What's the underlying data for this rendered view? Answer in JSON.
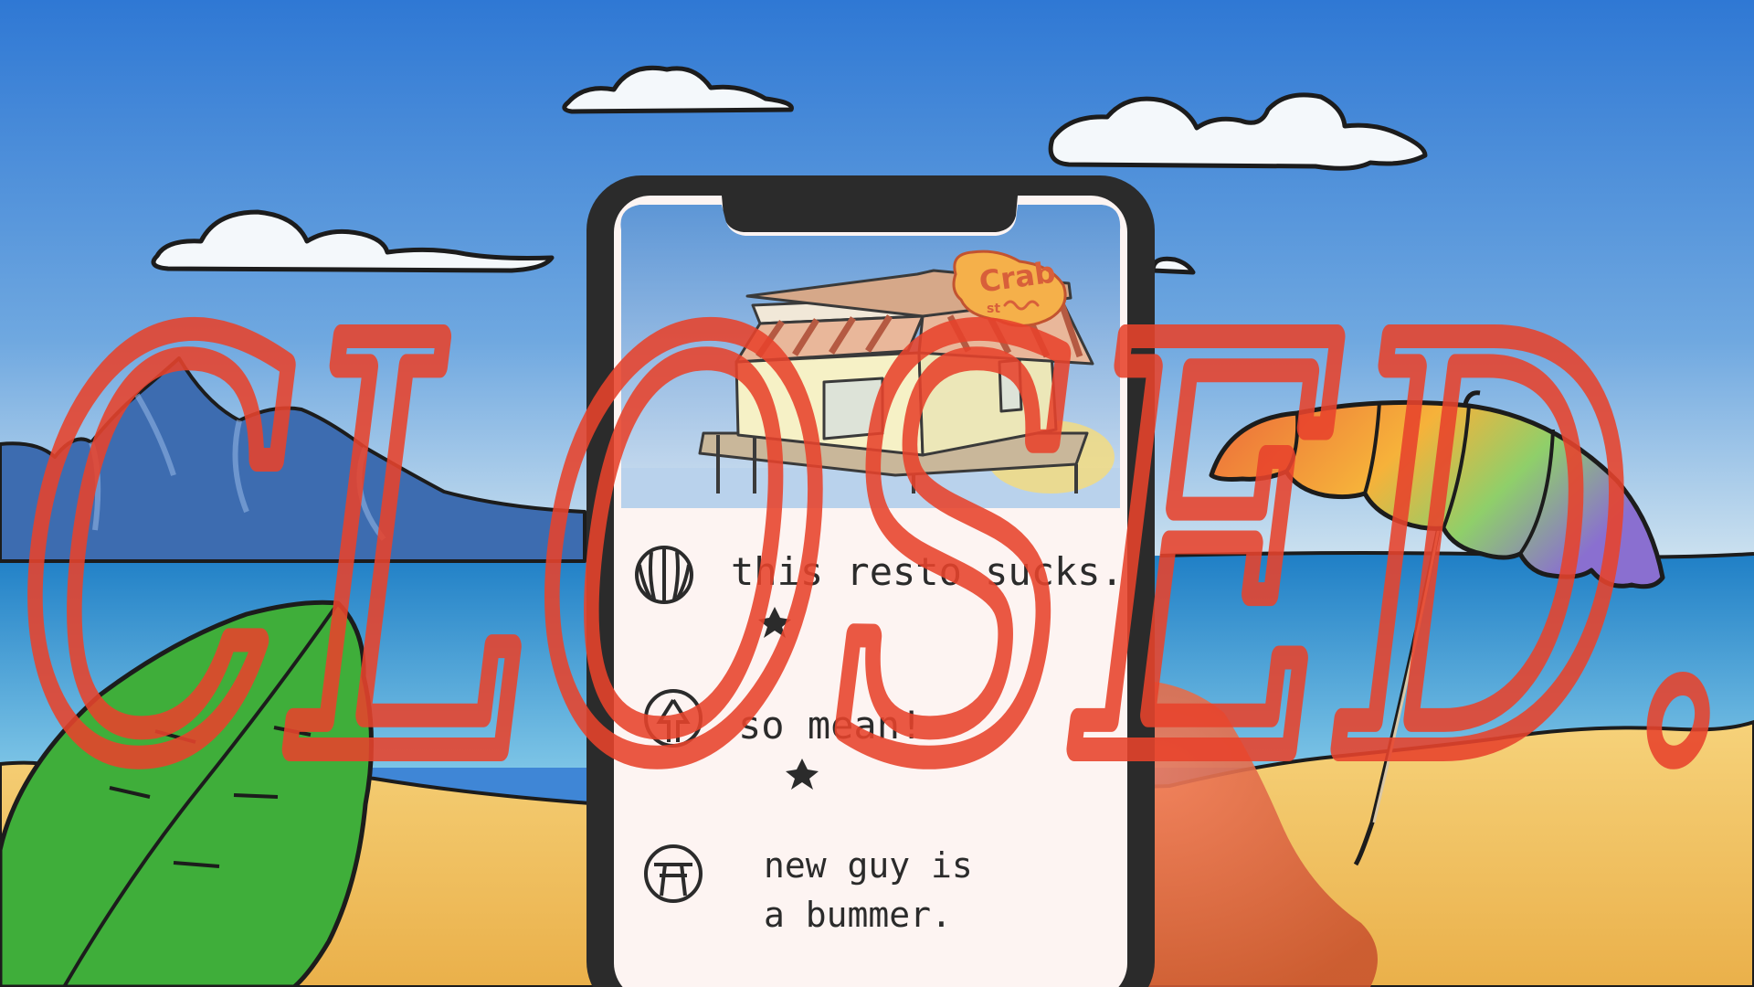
{
  "restaurant": {
    "sign": {
      "name": "Crab",
      "small": "st"
    }
  },
  "reviews": [
    {
      "lines": [
        "this resto sucks."
      ],
      "rating_mark": "star",
      "avatar": "shell-icon"
    },
    {
      "lines": [
        "so mean!"
      ],
      "rating_mark": "star",
      "avatar": "tree-icon"
    },
    {
      "lines": [
        "new guy is",
        "a bummer."
      ],
      "rating_mark": "",
      "avatar": "torii-icon"
    }
  ],
  "overlay": {
    "text": "CLOSED.",
    "color": "#e8432c"
  },
  "colors": {
    "sky": "#3f86d6",
    "sea": "#2f8fcf",
    "sand": "#f2c25a",
    "leaf": "#3fae3a",
    "phone_frame": "#2b2b2b",
    "screen": "#fdf4f2",
    "umbrella_warm": "#ec6a3a",
    "umbrella_cool": "#8a6fd0"
  }
}
